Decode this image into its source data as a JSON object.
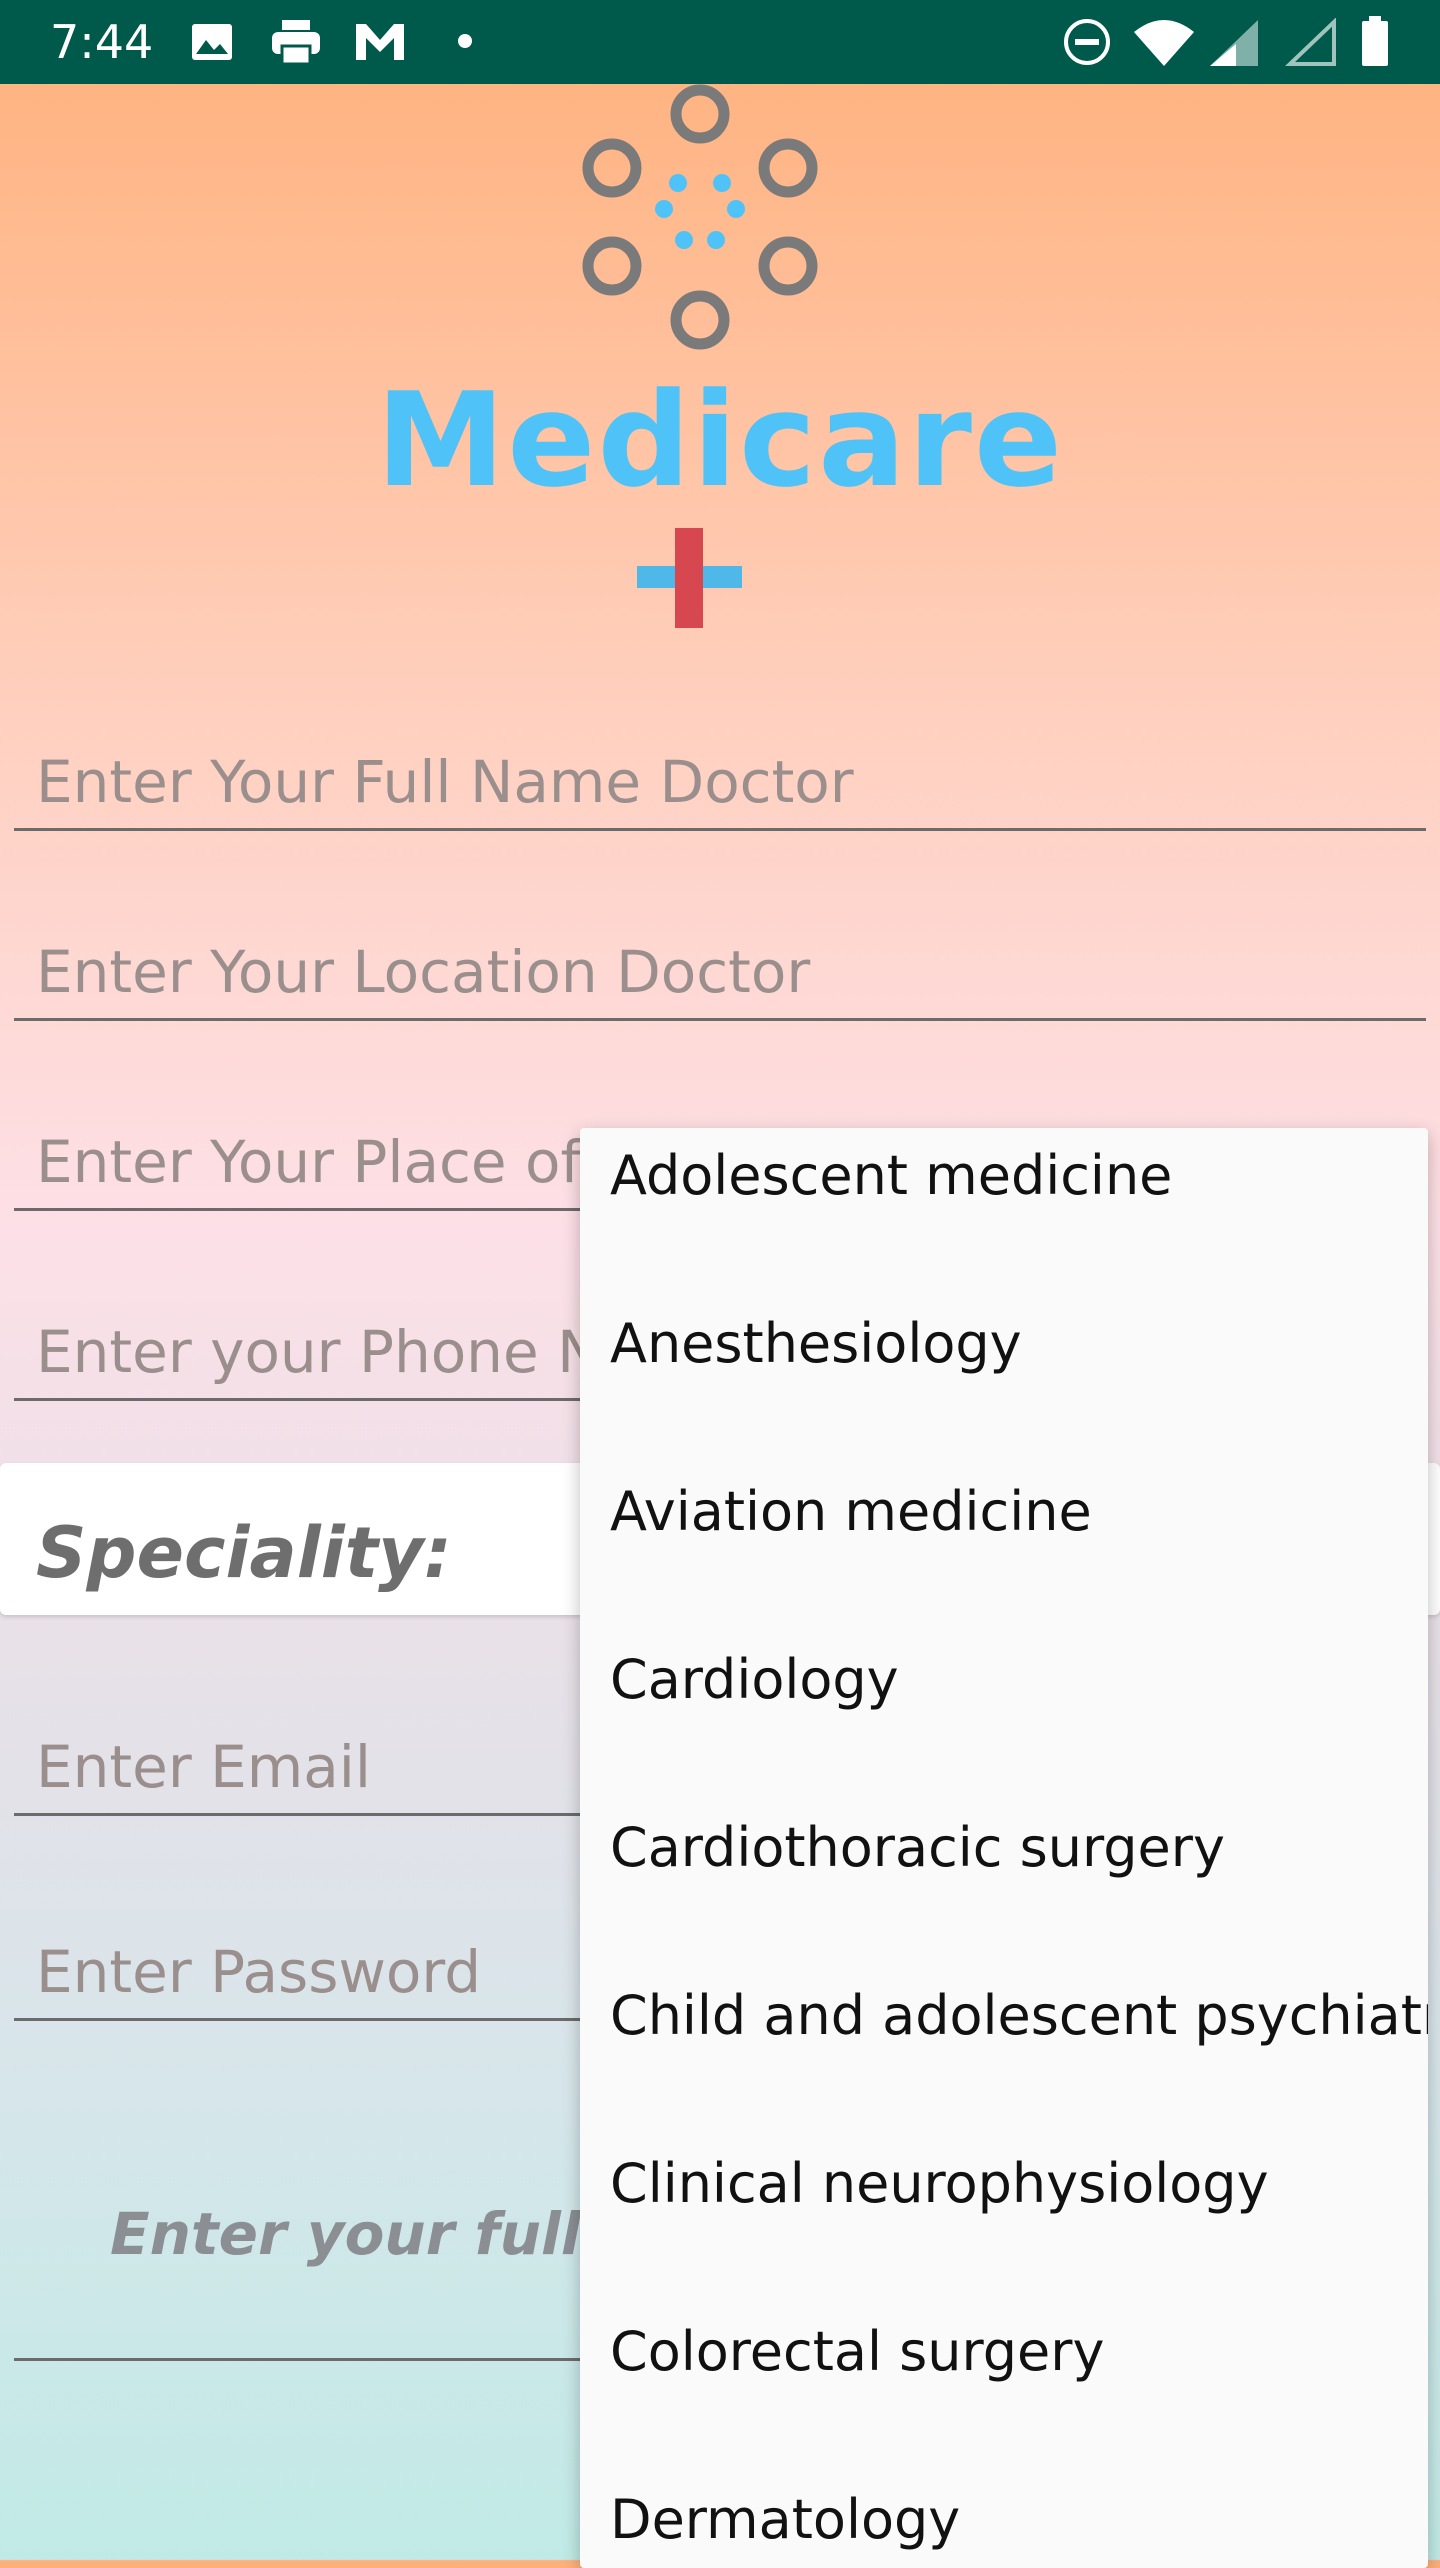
{
  "status_bar": {
    "time": "7:44",
    "background": "#005a4c",
    "icons": [
      "image-icon",
      "printer-icon",
      "gmail-icon",
      "dot-icon",
      "do-not-disturb-icon",
      "wifi-icon",
      "signal-icon",
      "signal-empty-icon",
      "battery-icon"
    ]
  },
  "brand": {
    "name": "Medicare",
    "color": "#4fc3f7"
  },
  "form": {
    "full_name_placeholder": "Enter Your Full Name Doctor",
    "location_placeholder": "Enter Your Location Doctor",
    "workplace_placeholder": "Enter Your Place of",
    "phone_placeholder": "Enter your Phone N",
    "speciality_label": "Speciality:",
    "email_placeholder": "Enter Email",
    "password_placeholder": "Enter Password",
    "bio_placeholder": "Enter your full Bi"
  },
  "speciality_dropdown": {
    "options": [
      "Adolescent medicine",
      "Anesthesiology",
      "Aviation medicine",
      "Cardiology",
      "Cardiothoracic surgery",
      "Child and adolescent psychiatry",
      "Clinical neurophysiology",
      "Colorectal surgery",
      "Dermatology"
    ]
  }
}
